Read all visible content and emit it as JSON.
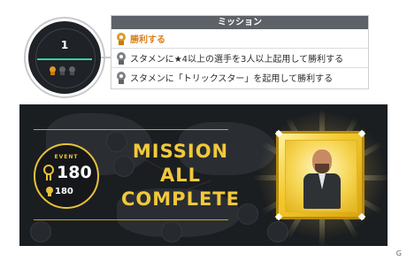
{
  "mission_badge": {
    "number": "1",
    "medals": [
      "gold-medal-icon",
      "gray-medal-icon",
      "gray-medal-icon"
    ]
  },
  "mission_panel": {
    "header": "ミッション",
    "rows": [
      {
        "text": "勝利する",
        "status": "completed",
        "icon": "gold-medal-icon"
      },
      {
        "text": "スタメンに★4以上の選手を3人以上起用して勝利する",
        "status": "incomplete",
        "icon": "gray-medal-icon"
      },
      {
        "text": "スタメンに「トリックスター」を起用して勝利する",
        "status": "incomplete",
        "icon": "gray-medal-icon"
      }
    ]
  },
  "banner": {
    "event_label": "EVENT",
    "event_points": "180",
    "sub_points": "180",
    "complete_lines": [
      "MISSION",
      "ALL",
      "COMPLETE"
    ]
  },
  "colors": {
    "gold": "#e8c23a",
    "completed_text": "#d97f16",
    "accent_line": "#38d0a5",
    "banner_bg": "#1b1e21"
  },
  "watermark": "G"
}
